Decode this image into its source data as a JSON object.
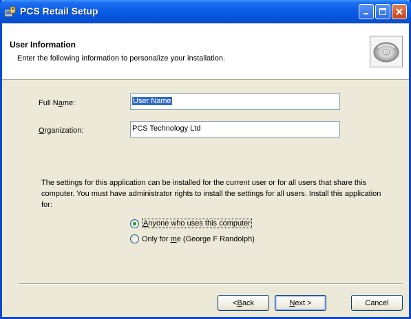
{
  "window": {
    "title": "PCS Retail Setup"
  },
  "header": {
    "title": "User Information",
    "subtitle": "Enter the following information to personalize your installation."
  },
  "form": {
    "full_name_label_pre": "Full N",
    "full_name_label_accel": "a",
    "full_name_label_post": "me:",
    "full_name_value": "User Name",
    "org_label_accel": "O",
    "org_label_post": "rganization:",
    "org_value": "PCS Technology Ltd"
  },
  "install_for": {
    "description": "The settings for this application can be installed for the current user or for all users that share this computer. You must have administrator rights to install the settings for all users. Install this application for:",
    "options": [
      {
        "accel": "A",
        "rest": "nyone who uses this computer",
        "selected": true
      },
      {
        "pre": "Only for ",
        "accel": "m",
        "rest": "e (George F Randolph)",
        "selected": false
      }
    ]
  },
  "buttons": {
    "back_prefix": "< ",
    "back_accel": "B",
    "back_rest": "ack",
    "next_accel": "N",
    "next_rest": "ext >",
    "cancel": "Cancel"
  },
  "colors": {
    "titlebar": "#0a5ee6",
    "dialog_bg": "#ece9d8",
    "selection": "#316ac5",
    "radio_selected": "#21a121"
  }
}
